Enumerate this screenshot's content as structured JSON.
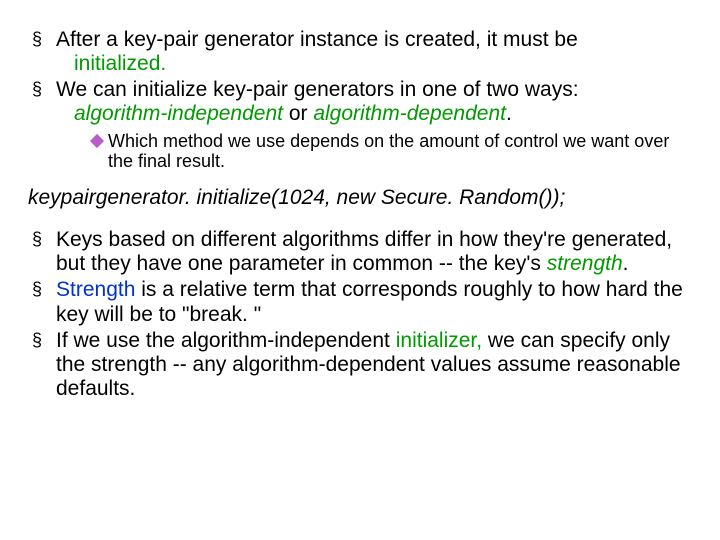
{
  "bullets_top": [
    {
      "pre": "After a key-pair generator instance is created, it must be",
      "runon": "initialized.",
      "runon_class": "green"
    },
    {
      "pre": "We can initialize key-pair generators in one of two ways:",
      "runon_segments": [
        {
          "text": "algorithm-independent",
          "class": "italic green"
        },
        {
          "text": " or ",
          "class": ""
        },
        {
          "text": "algorithm-dependent",
          "class": "italic green"
        },
        {
          "text": ".",
          "class": ""
        }
      ]
    }
  ],
  "sub_bullet": "Which method we use depends on the amount of control we want over the final result.",
  "code_line": "keypairgenerator. initialize(1024, new Secure. Random());",
  "bullets_bottom": [
    {
      "segments": [
        {
          "text": "Keys based on different algorithms differ in how they're generated, but they have one parameter in common -- the key's ",
          "class": ""
        },
        {
          "text": "strength",
          "class": "italic green"
        },
        {
          "text": ".",
          "class": ""
        }
      ]
    },
    {
      "segments": [
        {
          "text": "Strength",
          "class": "blue"
        },
        {
          "text": " is a relative term that corresponds roughly to how hard the key will be to \"break. \"",
          "class": ""
        }
      ]
    },
    {
      "segments": [
        {
          "text": "If we  use the algorithm-independent ",
          "class": ""
        },
        {
          "text": "initializer,",
          "class": "green"
        },
        {
          "text": " we can specify only the strength -- any algorithm-dependent values assume reasonable defaults.",
          "class": ""
        }
      ]
    }
  ],
  "markers": {
    "square": "§"
  }
}
